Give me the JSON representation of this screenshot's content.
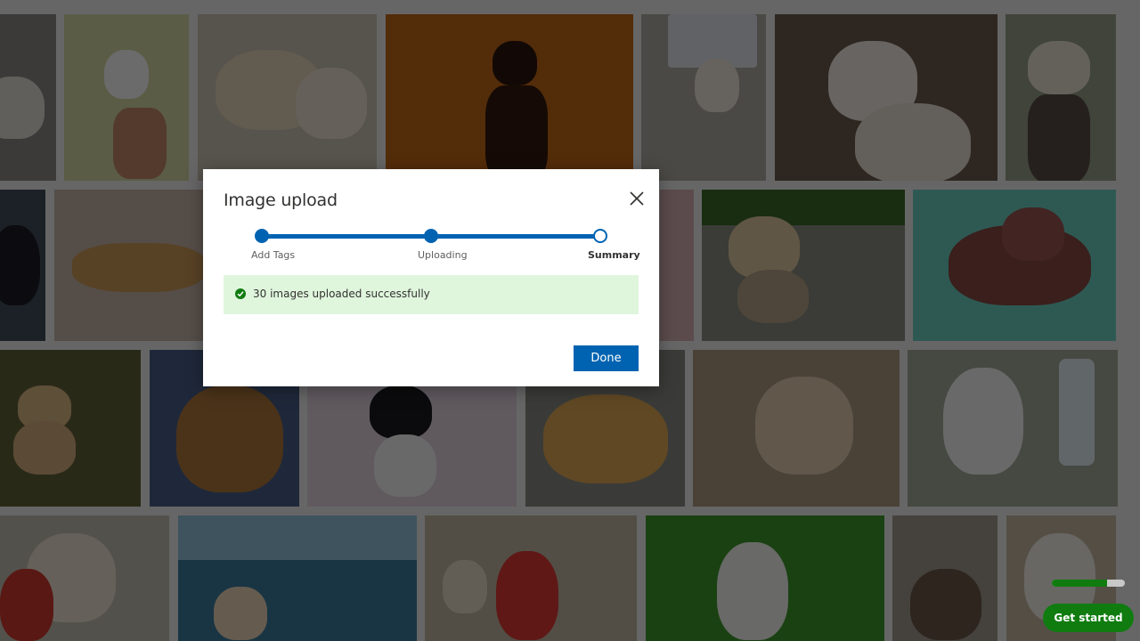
{
  "dialog": {
    "title": "Image upload",
    "close_icon": "close-icon",
    "steps": [
      {
        "label": "Add Tags",
        "state": "done"
      },
      {
        "label": "Uploading",
        "state": "done"
      },
      {
        "label": "Summary",
        "state": "current"
      }
    ],
    "success_message": "30 images uploaded successfully",
    "success_icon": "check-circle-icon",
    "done_label": "Done"
  },
  "floating": {
    "get_started_label": "Get started",
    "progress_fraction": 0.75
  },
  "colors": {
    "accent": "#0063b1",
    "success_bg": "#dff6dd",
    "success_green": "#107c10",
    "overlay": "rgba(0,0,0,0.58)"
  }
}
